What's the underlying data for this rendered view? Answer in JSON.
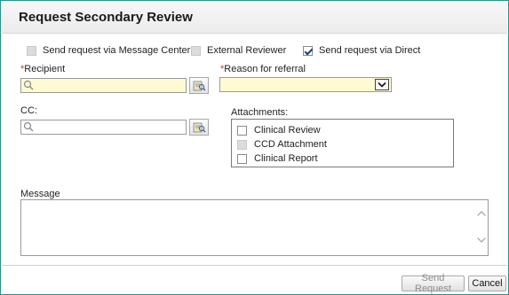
{
  "dialog": {
    "title": "Request Secondary Review"
  },
  "options": [
    {
      "label": "Send request via Message Center",
      "checked": false,
      "enabled": false
    },
    {
      "label": "External Reviewer",
      "checked": false,
      "enabled": false
    },
    {
      "label": "Send request via Direct",
      "checked": true,
      "enabled": true
    }
  ],
  "recipient": {
    "required_marker": "*",
    "label": "Recipient",
    "value": ""
  },
  "reason": {
    "required_marker": "*",
    "label": "Reason for referral",
    "selected": ""
  },
  "cc": {
    "label": "CC:",
    "value": ""
  },
  "attachments": {
    "label": "Attachments:",
    "items": [
      {
        "label": "Clinical Review",
        "checked": false,
        "enabled": true
      },
      {
        "label": "CCD Attachment",
        "checked": false,
        "enabled": false
      },
      {
        "label": "Clinical Report",
        "checked": false,
        "enabled": true
      }
    ]
  },
  "message": {
    "label": "Message",
    "value": ""
  },
  "buttons": {
    "send_request": "Send Request",
    "cancel": "Cancel"
  },
  "colors": {
    "frame": "#2e8f86",
    "required": "#c0392b",
    "field_highlight": "#fefad2",
    "check": "#1d3f7a"
  },
  "icons": {
    "search": "magnifier-icon",
    "lookup": "address-book-icon",
    "dropdown": "chevron-down-icon"
  }
}
